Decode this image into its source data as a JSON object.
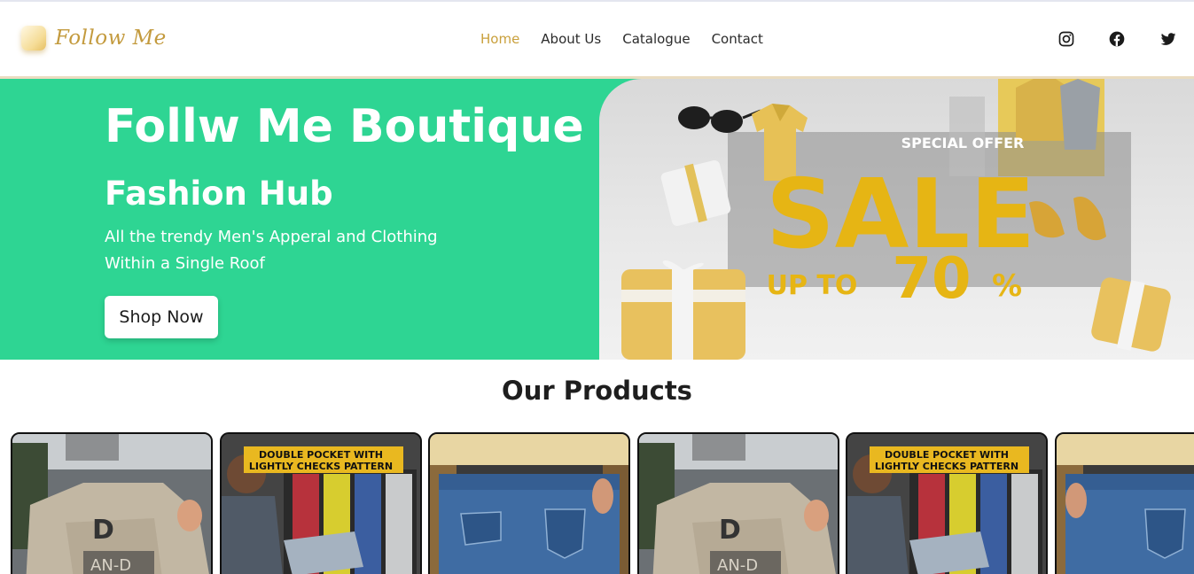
{
  "header": {
    "logo_text": "Follow Me",
    "nav": [
      {
        "label": "Home",
        "active": true
      },
      {
        "label": "About Us",
        "active": false
      },
      {
        "label": "Catalogue",
        "active": false
      },
      {
        "label": "Contact",
        "active": false
      }
    ],
    "social_icons": [
      "instagram-icon",
      "facebook-icon",
      "twitter-icon"
    ]
  },
  "hero": {
    "title": "Follw Me Boutique",
    "subtitle": "Fashion Hub",
    "description_line1": "All the trendy Men's Apperal and Clothing",
    "description_line2": "Within a Single Roof",
    "cta_label": "Shop Now",
    "background_color": "#2ed593",
    "banner": {
      "badge": "SPECIAL OFFER",
      "headline": "SALE",
      "offer_prefix": "UP TO",
      "offer_value": "70",
      "offer_suffix": "%"
    }
  },
  "products": {
    "section_title": "Our Products",
    "items": [
      {
        "type": "shirt",
        "caption": ""
      },
      {
        "type": "pocket-shirt",
        "caption_line1": "DOUBLE POCKET WITH",
        "caption_line2": "LIGHTLY CHECKS PATTERN"
      },
      {
        "type": "jeans",
        "caption": ""
      },
      {
        "type": "shirt",
        "caption": ""
      },
      {
        "type": "pocket-shirt",
        "caption_line1": "DOUBLE POCKET WITH",
        "caption_line2": "LIGHTLY CHECKS PATTERN"
      },
      {
        "type": "jeans",
        "caption": ""
      }
    ]
  },
  "colors": {
    "accent_gold": "#c9a03c",
    "hero_green": "#2ed593",
    "text_dark": "#1e1e1e"
  }
}
